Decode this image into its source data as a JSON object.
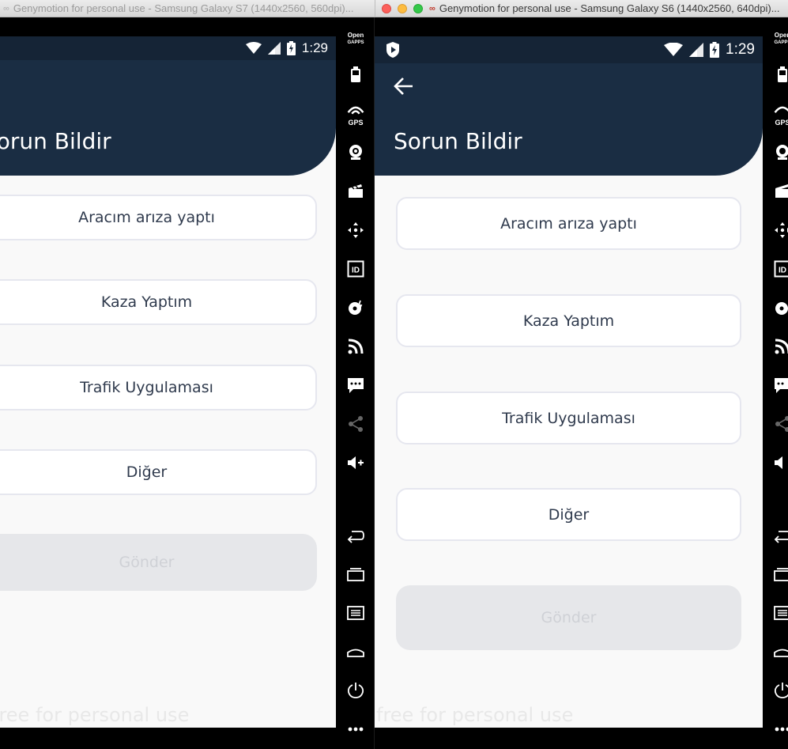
{
  "windows": [
    {
      "title": "Genymotion for personal use - Samsung Galaxy S7 (1440x2560, 560dpi)...",
      "status_time": "1:29",
      "page_title": "Sorun Bildir",
      "options": [
        "Aracım arıza yaptı",
        "Kaza Yaptım",
        "Trafik Uygulaması",
        "Diğer"
      ],
      "send_label": "Gönder",
      "watermark": "free for personal use"
    },
    {
      "title": "Genymotion for personal use - Samsung Galaxy S6 (1440x2560, 640dpi)...",
      "status_time": "1:29",
      "page_title": "Sorun Bildir",
      "options": [
        "Aracım arıza yaptı",
        "Kaza Yaptım",
        "Trafik Uygulaması",
        "Diğer"
      ],
      "send_label": "Gönder",
      "watermark": "free for personal use"
    }
  ],
  "toolbar": {
    "opengapps_top": "Open",
    "opengapps_bottom": "GAPPS",
    "gps_label": "GPS",
    "id_label": "ID",
    "icons": [
      "battery-icon",
      "gps-icon",
      "camera-icon",
      "screencast-icon",
      "dpad-icon",
      "device-id-icon",
      "disk-io-icon",
      "network-icon",
      "sms-icon",
      "share-icon",
      "volume-up-icon",
      "back-icon",
      "recent-apps-icon",
      "menu-icon",
      "home-icon",
      "power-icon",
      "more-icon"
    ]
  },
  "colors": {
    "appbar": "#1a2d43",
    "statusbar": "#152436",
    "background": "#f9f9f9",
    "button_text": "#2f3a4d",
    "disabled_button": "#e6e7ea"
  }
}
